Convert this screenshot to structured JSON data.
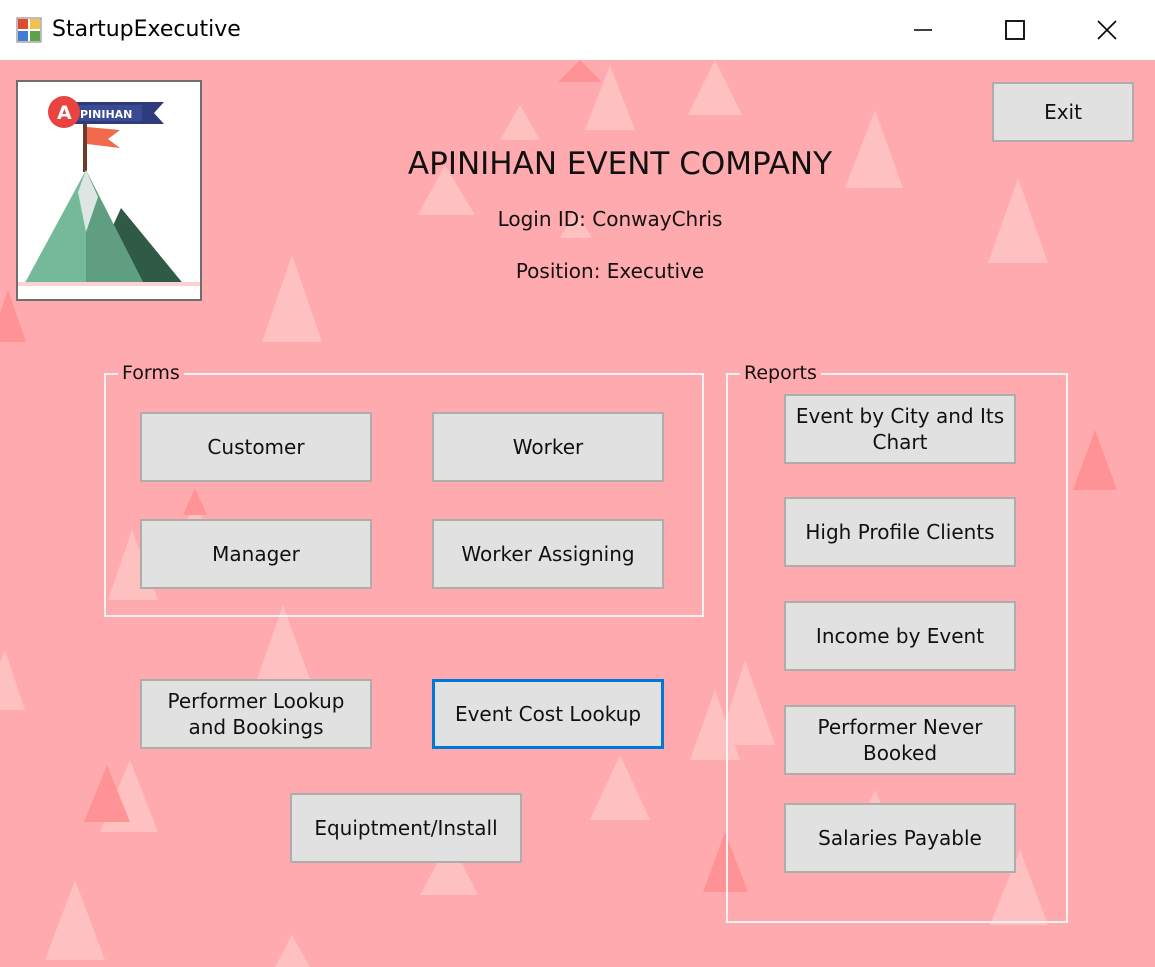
{
  "window": {
    "title": "StartupExecutive",
    "icon": "form-app-icon",
    "controls": [
      "minimize-icon",
      "maximize-icon",
      "close-icon"
    ]
  },
  "colors": {
    "background": "#ffaaae",
    "button_face": "#e1e1e1",
    "button_border": "#adadad",
    "focus_border": "#0078d7",
    "group_border": "#f2f2f2"
  },
  "logo": {
    "text": "PINIHAN",
    "badge_letter": "A"
  },
  "header": {
    "company": "APINIHAN EVENT COMPANY",
    "login": "Login ID: ConwayChris",
    "position": "Position: Executive"
  },
  "exit_label": "Exit",
  "forms": {
    "label": "Forms",
    "customer": "Customer",
    "worker": "Worker",
    "manager": "Manager",
    "worker_assigning": "Worker Assigning"
  },
  "lookups": {
    "performer": "Performer Lookup\nand Bookings",
    "event_cost": "Event Cost Lookup",
    "equipment": "Equiptment/Install"
  },
  "reports": {
    "label": "Reports",
    "event_by_city": "Event by City and Its\nChart",
    "high_profile": "High Profile Clients",
    "income_by_event": "Income by Event",
    "never_booked": "Performer Never\nBooked",
    "salaries": "Salaries Payable"
  }
}
